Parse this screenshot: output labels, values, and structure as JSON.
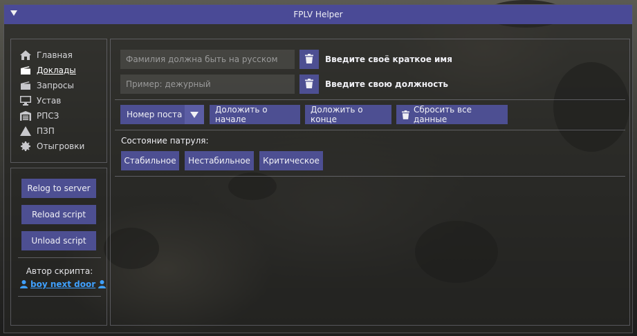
{
  "window": {
    "title": "FPLV Helper"
  },
  "nav": {
    "items": [
      {
        "label": "Главная",
        "icon": "home-icon"
      },
      {
        "label": "Доклады",
        "icon": "radio-icon",
        "active": true
      },
      {
        "label": "Запросы",
        "icon": "radio-icon"
      },
      {
        "label": "Устав",
        "icon": "monitor-icon"
      },
      {
        "label": "РПСЗ",
        "icon": "warehouse-icon"
      },
      {
        "label": "ПЗП",
        "icon": "warning-icon"
      },
      {
        "label": "Отыгровки",
        "icon": "gear-icon"
      }
    ]
  },
  "side": {
    "relog_label": "Relog to server",
    "reload_label": "Reload script",
    "unload_label": "Unload script",
    "author_label": "Автор скрипта:",
    "author_name": "boy next door"
  },
  "main": {
    "surname_placeholder": "Фамилия должна быть на русском",
    "surname_value": "",
    "surname_label": "Введите своё краткое имя",
    "position_placeholder": "Пример: дежурный",
    "position_value": "",
    "position_label": "Введите свою должность",
    "post_select_value": "Номер поста",
    "report_start_label": "Доложить о начале",
    "report_end_label": "Доложить о конце",
    "reset_label": "Сбросить все данные",
    "patrol_state_label": "Состояние патруля:",
    "states": [
      "Стабильное",
      "Нестабильное",
      "Критическое"
    ]
  },
  "colors": {
    "titlebar": "#4a4a96",
    "button": "#4d4f92",
    "link": "#3fa0ff"
  }
}
